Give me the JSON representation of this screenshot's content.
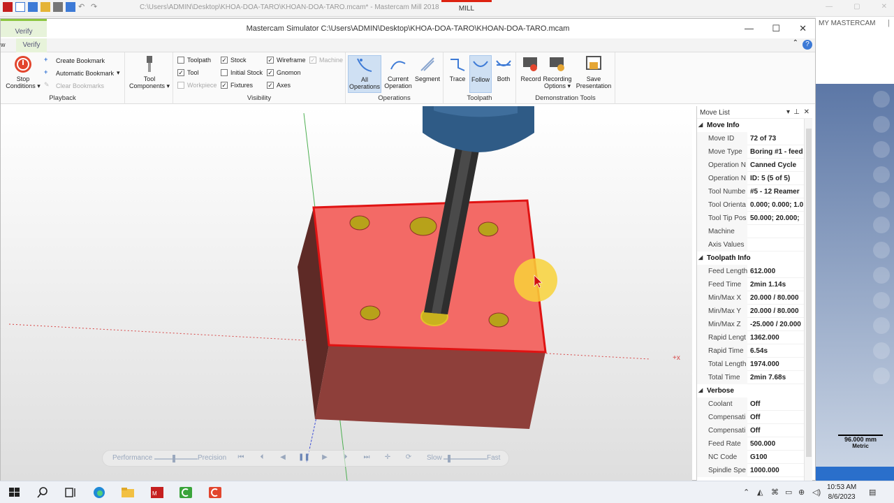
{
  "bg_window": {
    "title": "C:\\Users\\ADMIN\\Desktop\\KHOA-DOA-TARO\\KHOAN-DOA-TARO.mcam* - Mastercam Mill 2018",
    "mode_tab": "MILL",
    "right_panel_title": "MY MASTERCAM",
    "scale_value": "96.000 mm",
    "scale_unit": "Metric"
  },
  "simulator": {
    "top_tab": "Verify",
    "title": "Mastercam Simulator  C:\\Users\\ADMIN\\Desktop\\KHOA-DOA-TARO\\KHOAN-DOA-TARO.mcam",
    "tab_fragment": "w",
    "active_tab": "Verify"
  },
  "ribbon": {
    "playback": {
      "label": "Playback",
      "stop_conditions": "Stop Conditions",
      "create_bookmark": "Create Bookmark",
      "automatic_bookmark": "Automatic Bookmark",
      "clear_bookmarks": "Clear Bookmarks"
    },
    "tool_components": "Tool Components",
    "visibility": {
      "label": "Visibility",
      "toolpath": "Toolpath",
      "tool": "Tool",
      "workpiece": "Workpiece",
      "stock": "Stock",
      "initial_stock": "Initial Stock",
      "fixtures": "Fixtures",
      "wireframe": "Wireframe",
      "gnomon": "Gnomon",
      "axes": "Axes",
      "machine": "Machine"
    },
    "operations": {
      "label": "Operations",
      "all": "All Operations",
      "current": "Current Operation",
      "segment": "Segment"
    },
    "toolpath": {
      "label": "Toolpath",
      "trace": "Trace",
      "follow": "Follow",
      "both": "Both"
    },
    "demo": {
      "label": "Demonstration Tools",
      "record": "Record",
      "recording_options": "Recording Options",
      "save_presentation": "Save Presentation"
    }
  },
  "playbar": {
    "performance": "Performance",
    "precision": "Precision",
    "slow": "Slow",
    "fast": "Fast"
  },
  "move_list": {
    "title": "Move List",
    "move_info": {
      "label": "Move Info",
      "rows": [
        {
          "k": "Move ID",
          "v": "72 of 73"
        },
        {
          "k": "Move Type",
          "v": "Boring #1 - feed"
        },
        {
          "k": "Operation N",
          "v": "Canned Cycle"
        },
        {
          "k": "Operation N",
          "v": "ID: 5 (5 of 5)"
        },
        {
          "k": "Tool Numbe",
          "v": "#5 - 12 Reamer"
        },
        {
          "k": "Tool Orienta",
          "v": "0.000; 0.000; 1.0"
        },
        {
          "k": "Tool Tip Pos",
          "v": "50.000; 20.000;"
        },
        {
          "k": "Machine",
          "v": ""
        },
        {
          "k": "Axis Values",
          "v": ""
        }
      ]
    },
    "toolpath_info": {
      "label": "Toolpath Info",
      "rows": [
        {
          "k": "Feed Length",
          "v": "612.000"
        },
        {
          "k": "Feed Time",
          "v": "2min 1.14s"
        },
        {
          "k": "Min/Max X",
          "v": "20.000 / 80.000"
        },
        {
          "k": "Min/Max Y",
          "v": "20.000 / 80.000"
        },
        {
          "k": "Min/Max Z",
          "v": "-25.000 / 20.000"
        },
        {
          "k": "Rapid Lengt",
          "v": "1362.000"
        },
        {
          "k": "Rapid Time",
          "v": "6.54s"
        },
        {
          "k": "Total Length",
          "v": "1974.000"
        },
        {
          "k": "Total Time",
          "v": "2min 7.68s"
        }
      ]
    },
    "verbose": {
      "label": "Verbose",
      "rows": [
        {
          "k": "Coolant",
          "v": "Off"
        },
        {
          "k": "Compensati",
          "v": "Off"
        },
        {
          "k": "Compensati",
          "v": "Off"
        },
        {
          "k": "Feed Rate",
          "v": "500.000"
        },
        {
          "k": "NC Code",
          "v": "G100"
        },
        {
          "k": "Spindle Spe",
          "v": "1000.000"
        }
      ]
    }
  },
  "taskbar": {
    "time": "10:53 AM",
    "date": "8/6/2023"
  },
  "colors": {
    "stock_top": "#f36a66",
    "stock_side": "#8e3f3a",
    "spindle": "#2f5b86",
    "hole": "#b7a21a",
    "accent_blue": "#3d7ad6"
  }
}
